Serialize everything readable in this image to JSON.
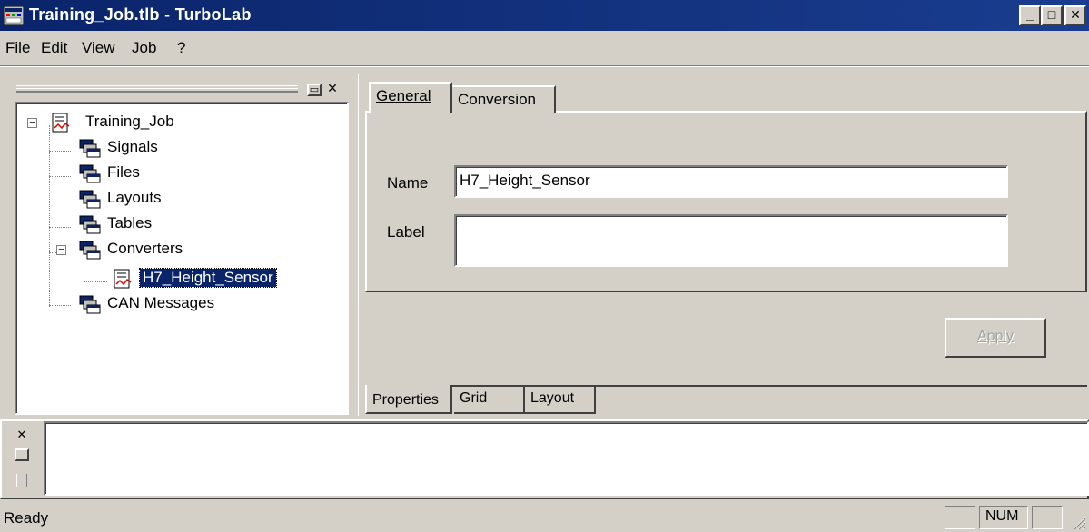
{
  "window": {
    "title": "Training_Job.tlb - TurboLab",
    "controls": {
      "minimize": "_",
      "maximize": "□",
      "close": "✕"
    }
  },
  "menu": [
    {
      "label": "File"
    },
    {
      "label": "Edit"
    },
    {
      "label": "View"
    },
    {
      "label": "Job"
    },
    {
      "label": "?"
    }
  ],
  "tree": {
    "root": "Training_Job",
    "items": [
      {
        "label": "Signals"
      },
      {
        "label": "Files"
      },
      {
        "label": "Layouts"
      },
      {
        "label": "Tables"
      },
      {
        "label": "Converters"
      },
      {
        "label": "H7_Height_Sensor",
        "selected": true
      },
      {
        "label": "CAN Messages"
      }
    ]
  },
  "tabs_top": [
    {
      "label": "General",
      "active": true
    },
    {
      "label": "Conversion"
    }
  ],
  "form": {
    "name_label": "Name",
    "name_value": "H7_Height_Sensor",
    "label_label": "Label",
    "label_value": ""
  },
  "apply_label": "Apply",
  "tabs_bottom": [
    {
      "label": "Properties",
      "active": true
    },
    {
      "label": "Grid"
    },
    {
      "label": "Layout"
    }
  ],
  "status": {
    "text": "Ready",
    "indicators": [
      "",
      "NUM",
      ""
    ]
  },
  "colors": {
    "titlebar": "#0a246a",
    "face": "#d4d0c8",
    "selection": "#0a246a"
  }
}
